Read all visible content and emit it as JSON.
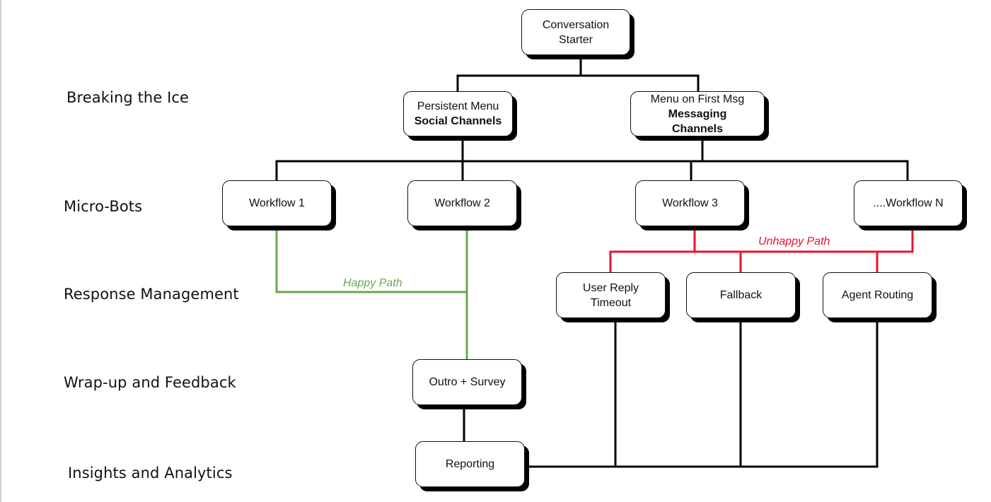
{
  "colors": {
    "happy_path": "#6aa84f",
    "unhappy_path": "#e8132b",
    "connector": "#000000"
  },
  "stages": [
    {
      "id": "breaking-the-ice",
      "label": "Breaking the Ice"
    },
    {
      "id": "micro-bots",
      "label": "Micro-Bots"
    },
    {
      "id": "response-management",
      "label": "Response Management"
    },
    {
      "id": "wrap-up-and-feedback",
      "label": "Wrap-up and Feedback"
    },
    {
      "id": "insights-and-analytics",
      "label": "Insights and Analytics"
    }
  ],
  "nodes": {
    "conversation_starter": {
      "line1": "Conversation",
      "line2": "Starter"
    },
    "persistent_menu": {
      "line1": "Persistent Menu",
      "line2_bold": "Social Channels"
    },
    "menu_first_msg": {
      "line1": "Menu on First Msg",
      "line2_bold": "Messaging",
      "line3_bold": "Channels"
    },
    "workflow_1": {
      "label": "Workflow 1"
    },
    "workflow_2": {
      "label": "Workflow 2"
    },
    "workflow_3": {
      "label": "Workflow 3"
    },
    "workflow_n": {
      "label": "....Workflow N"
    },
    "user_reply_timeout": {
      "line1": "User Reply",
      "line2": "Timeout"
    },
    "fallback": {
      "label": "Fallback"
    },
    "agent_routing": {
      "label": "Agent Routing"
    },
    "outro_survey": {
      "label": "Outro + Survey"
    },
    "reporting": {
      "label": "Reporting"
    }
  },
  "edges": [
    {
      "from": "conversation_starter",
      "to": "persistent_menu",
      "type": "normal"
    },
    {
      "from": "conversation_starter",
      "to": "menu_first_msg",
      "type": "normal"
    },
    {
      "from": "persistent_menu",
      "to": "workflow_1",
      "type": "normal"
    },
    {
      "from": "persistent_menu",
      "to": "workflow_2",
      "type": "normal"
    },
    {
      "from": "menu_first_msg",
      "to": "workflow_3",
      "type": "normal"
    },
    {
      "from": "menu_first_msg",
      "to": "workflow_n",
      "type": "normal"
    },
    {
      "from": "workflow_1",
      "to": "outro_survey",
      "type": "happy"
    },
    {
      "from": "workflow_2",
      "to": "outro_survey",
      "type": "happy"
    },
    {
      "from": "workflow_3",
      "to": "user_reply_timeout",
      "type": "unhappy"
    },
    {
      "from": "workflow_3",
      "to": "fallback",
      "type": "unhappy"
    },
    {
      "from": "workflow_n",
      "to": "agent_routing",
      "type": "unhappy"
    },
    {
      "from": "outro_survey",
      "to": "reporting",
      "type": "normal"
    },
    {
      "from": "user_reply_timeout",
      "to": "reporting",
      "type": "normal"
    },
    {
      "from": "fallback",
      "to": "reporting",
      "type": "normal"
    },
    {
      "from": "agent_routing",
      "to": "reporting",
      "type": "normal"
    }
  ],
  "path_labels": {
    "happy": "Happy Path",
    "unhappy": "Unhappy Path"
  }
}
